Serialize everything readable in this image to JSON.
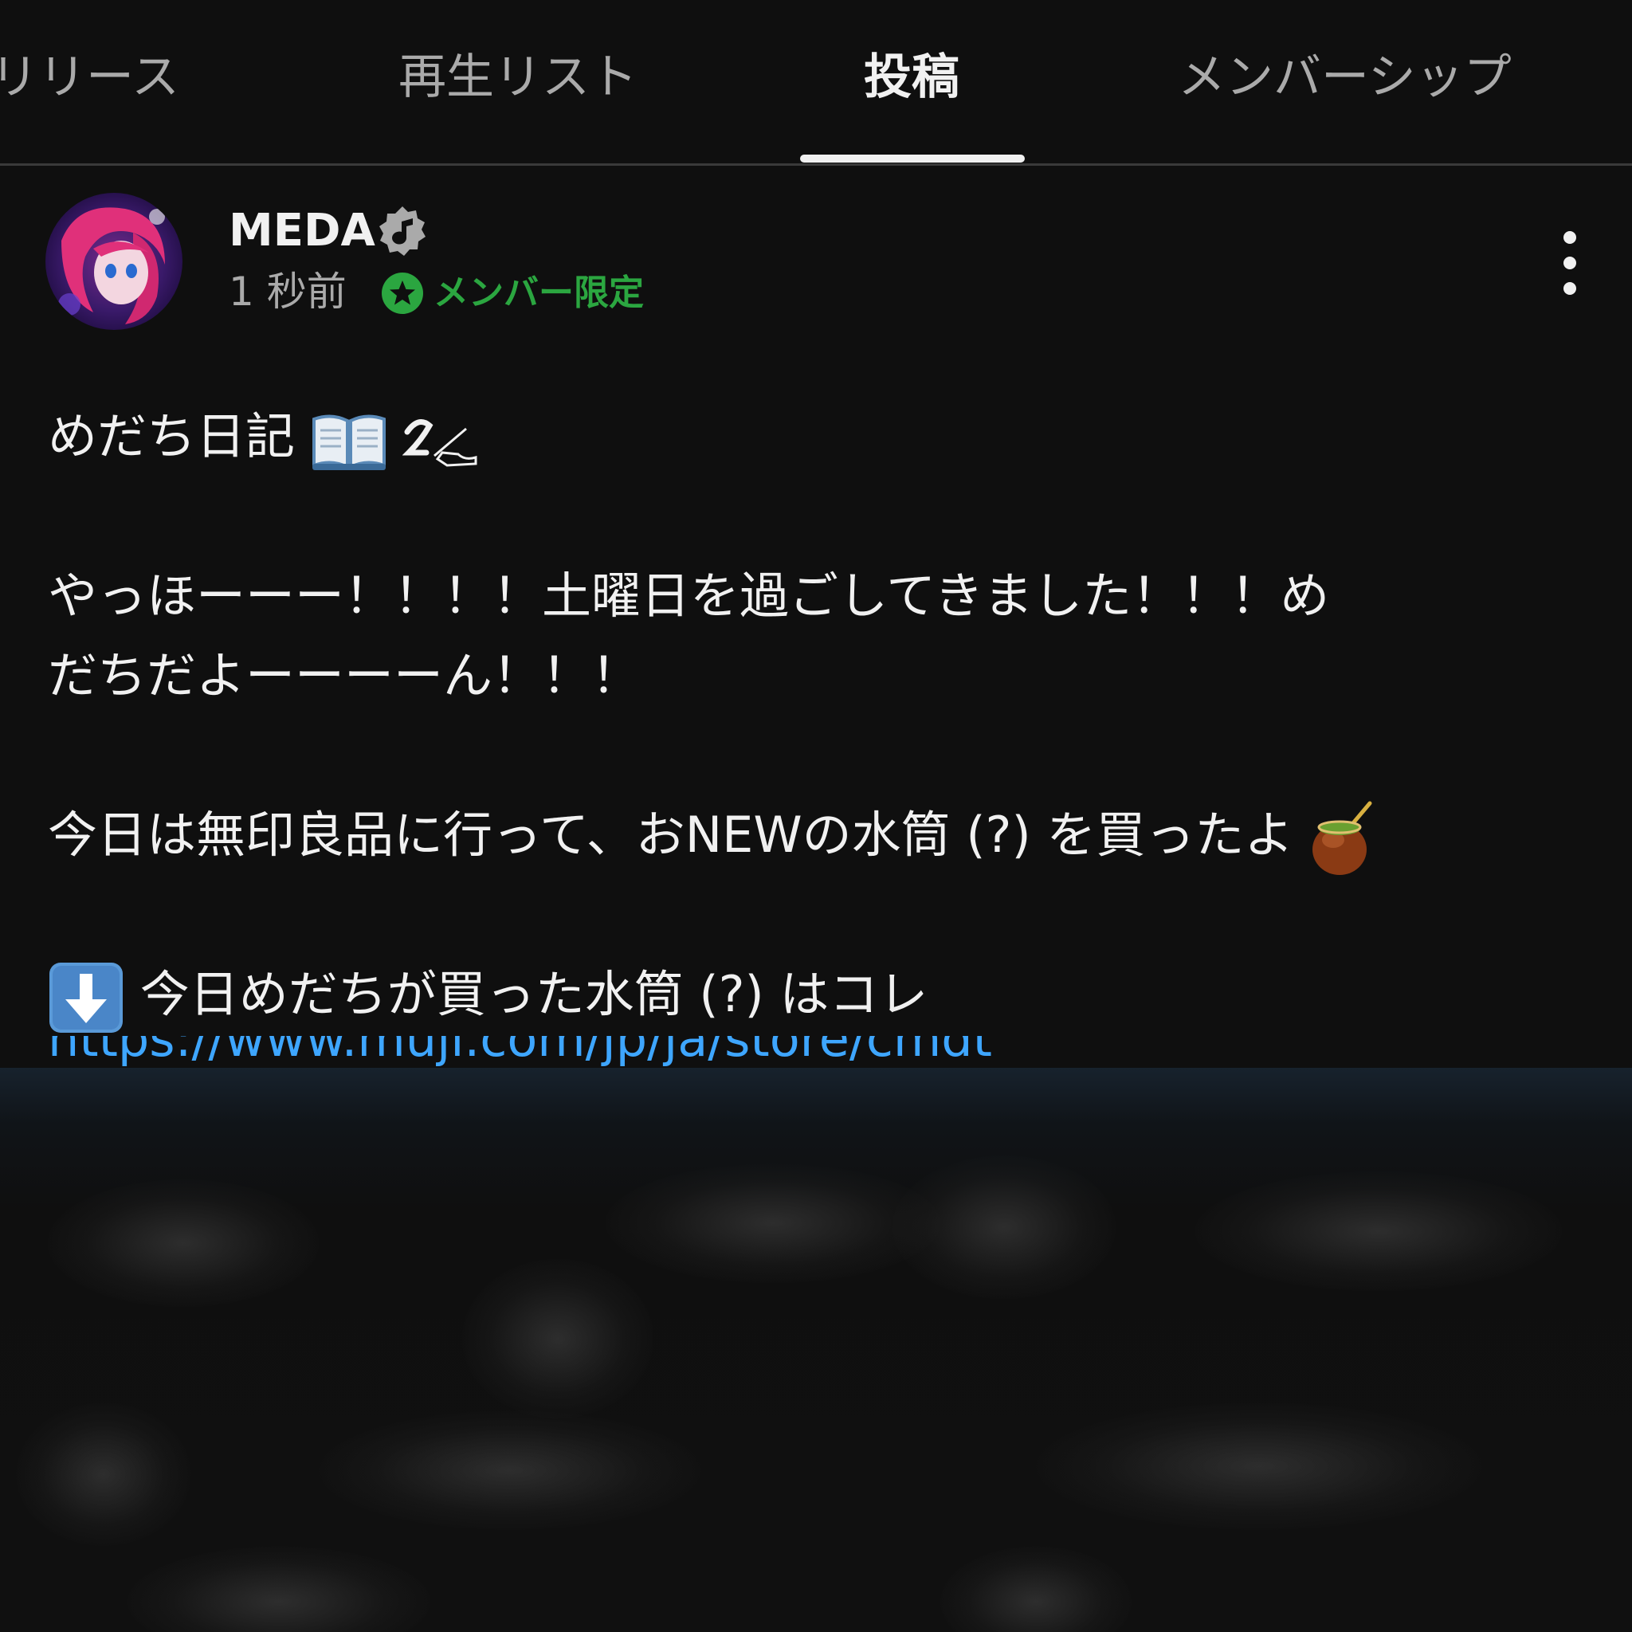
{
  "tabs": [
    {
      "label": "リリース"
    },
    {
      "label": "再生リスト"
    },
    {
      "label": "投稿"
    },
    {
      "label": "メンバーシップ"
    }
  ],
  "active_tab": "投稿",
  "post": {
    "channel_name": "MEDA",
    "time": "1 秒前",
    "members_only_label": "メンバー限定",
    "lines": [
      "めだち日記",
      "やっほーーー！！！！土曜日を過ごしてきました！！！め",
      "だちだよーーーーん！！！",
      "今日は無印良品に行って、おNEWの水筒 (?) を買ったよ",
      "今日めだちが買った水筒 (?) はコレ"
    ],
    "link": "https://www.muji.com/jp/ja/store/cmdt"
  },
  "icons": {
    "avatar": "avatar-image",
    "verified": "music-note-badge-icon",
    "members": "star-badge-icon",
    "more": "more-vert-icon",
    "book": "open-book-icon",
    "writing": "writing-hand-icon",
    "mate": "mate-cup-icon",
    "down_arrow": "down-arrow-icon"
  },
  "colors": {
    "background": "#0f0f0f",
    "text": "#f1f1f1",
    "secondary_text": "#aaaaaa",
    "members_green": "#2ba640",
    "link_blue": "#3ea6ff"
  }
}
